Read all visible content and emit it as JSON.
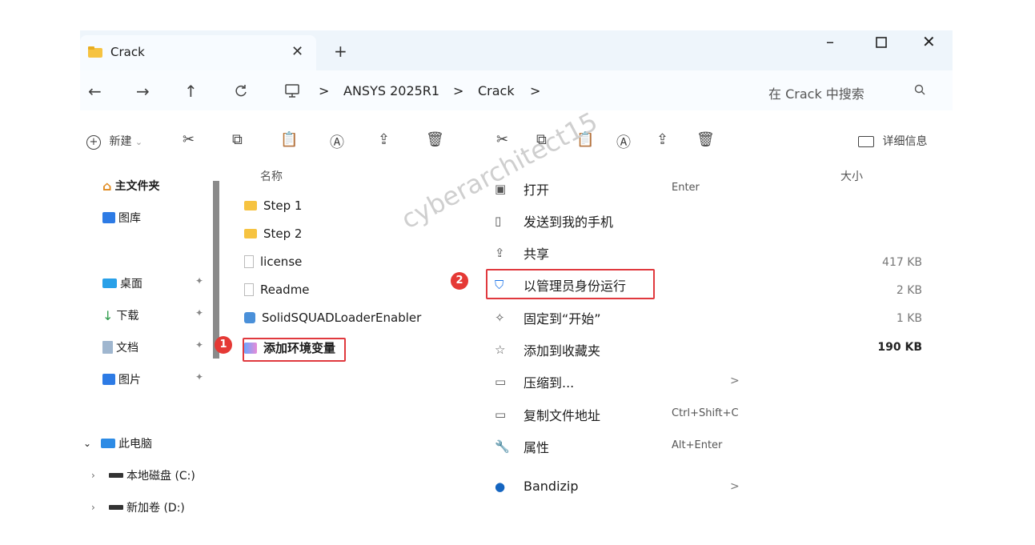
{
  "tab": {
    "title": "Crack"
  },
  "window_controls": {
    "minimize": "–",
    "maximize": "☐",
    "close": "✕"
  },
  "nav": {
    "back": "←",
    "forward": "→",
    "up": "↑",
    "refresh": "C"
  },
  "breadcrumb": [
    "ANSYS 2025R1",
    "Crack"
  ],
  "breadcrumb_sep": ">",
  "search": {
    "placeholder": "在 Crack 中搜索"
  },
  "toolbar": {
    "new_label": "新建",
    "details_label": "详细信息"
  },
  "sidebar": {
    "items": [
      {
        "label": "主文件夹",
        "icon": "home-icon"
      },
      {
        "label": "图库",
        "icon": "gallery-icon"
      },
      {
        "label": "桌面",
        "icon": "desktop-icon",
        "pinned": true
      },
      {
        "label": "下载",
        "icon": "download-icon",
        "pinned": true
      },
      {
        "label": "文档",
        "icon": "documents-icon",
        "pinned": true
      },
      {
        "label": "图片",
        "icon": "pictures-icon",
        "pinned": true
      },
      {
        "label": "此电脑",
        "icon": "pc-icon"
      },
      {
        "label": "本地磁盘 (C:)",
        "icon": "drive-icon"
      },
      {
        "label": "新加卷 (D:)",
        "icon": "drive-icon"
      }
    ]
  },
  "columns": {
    "name": "名称",
    "size": "大小"
  },
  "files": [
    {
      "name": "Step 1",
      "type": "folder",
      "size": ""
    },
    {
      "name": "Step 2",
      "type": "folder",
      "size": ""
    },
    {
      "name": "license",
      "type": "file",
      "size": "417 KB"
    },
    {
      "name": "Readme",
      "type": "file",
      "size": "2 KB"
    },
    {
      "name": "SolidSQUADLoaderEnabler",
      "type": "app",
      "size": "1 KB"
    },
    {
      "name": "添加环境变量",
      "type": "script",
      "size": "190 KB"
    }
  ],
  "context_menu": {
    "items": [
      {
        "label": "打开",
        "icon": "open-icon",
        "shortcut": "Enter"
      },
      {
        "label": "发送到我的手机",
        "icon": "phone-icon"
      },
      {
        "label": "共享",
        "icon": "share-icon"
      },
      {
        "label": "以管理员身份运行",
        "icon": "admin-shield-icon"
      },
      {
        "label": "固定到“开始”",
        "icon": "pin-icon"
      },
      {
        "label": "添加到收藏夹",
        "icon": "star-icon"
      },
      {
        "label": "压缩到...",
        "icon": "zip-icon",
        "submenu": true
      },
      {
        "label": "复制文件地址",
        "icon": "copy-path-icon",
        "shortcut": "Ctrl+Shift+C"
      },
      {
        "label": "属性",
        "icon": "properties-icon",
        "shortcut": "Alt+Enter"
      },
      {
        "label": "Bandizip",
        "icon": "bandizip-icon",
        "submenu": true
      }
    ],
    "submenu_arrow": ">"
  },
  "annotations": {
    "badge1": "1",
    "badge2": "2"
  },
  "watermark": "cyberarchitect15",
  "colors": {
    "highlight": "#e0393e",
    "folder": "#f6c341",
    "accent": "#1a73e8"
  }
}
